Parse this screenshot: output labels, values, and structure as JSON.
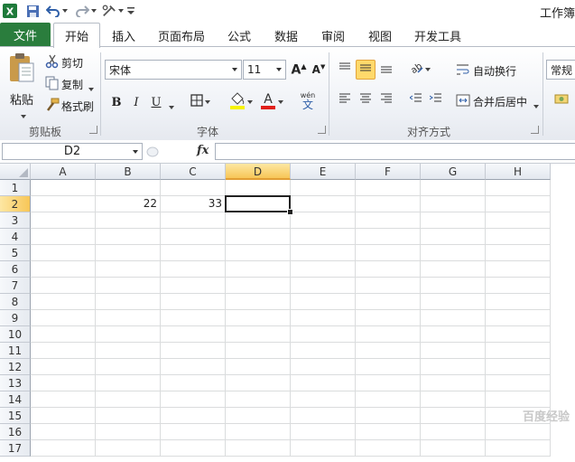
{
  "title": "工作簿",
  "tabs": [
    {
      "label": "文件"
    },
    {
      "label": "开始"
    },
    {
      "label": "插入"
    },
    {
      "label": "页面布局"
    },
    {
      "label": "公式"
    },
    {
      "label": "数据"
    },
    {
      "label": "审阅"
    },
    {
      "label": "视图"
    },
    {
      "label": "开发工具"
    }
  ],
  "clipboard": {
    "paste": "粘贴",
    "cut": "剪切",
    "copy": "复制",
    "format_painter": "格式刷",
    "group": "剪贴板"
  },
  "font": {
    "name": "宋体",
    "size": "11",
    "bold": "B",
    "italic": "I",
    "underline": "U",
    "group": "字体"
  },
  "alignment": {
    "wrap_text": "自动换行",
    "merge_center": "合并后居中",
    "group": "对齐方式"
  },
  "number": {
    "format": "常规"
  },
  "formula_bar": {
    "name_box": "D2",
    "fx": "fx",
    "formula": ""
  },
  "sheet": {
    "columns": [
      "A",
      "B",
      "C",
      "D",
      "E",
      "F",
      "G",
      "H"
    ],
    "rows": [
      "1",
      "2",
      "3",
      "4",
      "5",
      "6",
      "7",
      "8",
      "9",
      "10",
      "11",
      "12",
      "13",
      "14",
      "15",
      "16",
      "17"
    ],
    "active_cell": "D2",
    "cells": [
      {
        "ref": "B2",
        "value": "22"
      },
      {
        "ref": "C2",
        "value": "33"
      }
    ]
  },
  "watermark": "百度经验",
  "colors": {
    "file_tab": "#2a7d3d",
    "active_header": "#f7c657",
    "selected_button": "#ffd96b"
  }
}
